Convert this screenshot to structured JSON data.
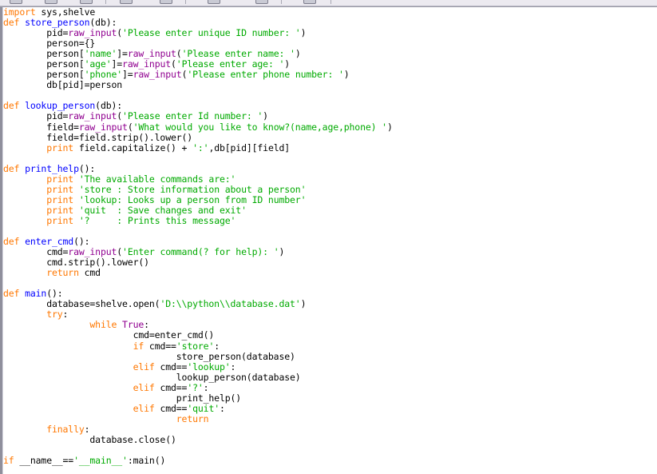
{
  "window": {
    "kind": "python-code-editor",
    "background": "#ffffff",
    "frame_color": "#8f8f9c",
    "toolbar_color": "#eceaf0"
  },
  "palette": {
    "keyword": "#ff7700",
    "definition": "#0000ff",
    "string": "#00aa00",
    "builtin": "#900090",
    "plain": "#000000",
    "background": "#ffffff"
  },
  "toolbar": {
    "visible_sliver": true,
    "button_positions": [
      12,
      56,
      100,
      150,
      200,
      260,
      320,
      380
    ],
    "separator_positions": [
      132,
      232,
      352,
      414
    ]
  },
  "editor": {
    "language": "Python 2",
    "font_size_px": 11.5,
    "line_height_px": 13.05,
    "indent_unit": "tab",
    "code_lines": [
      [
        [
          "import",
          "kw"
        ],
        [
          " sys,shelve",
          "plain"
        ]
      ],
      [
        [
          "def",
          "kw"
        ],
        [
          " ",
          "plain"
        ],
        [
          "store_person",
          "def"
        ],
        [
          "(db):",
          "plain"
        ]
      ],
      [
        [
          "        pid=",
          "plain"
        ],
        [
          "raw_input",
          "bi"
        ],
        [
          "(",
          "plain"
        ],
        [
          "'Please enter unique ID number: '",
          "str"
        ],
        [
          ")",
          "plain"
        ]
      ],
      [
        [
          "        person={}",
          "plain"
        ]
      ],
      [
        [
          "        person[",
          "plain"
        ],
        [
          "'name'",
          "str"
        ],
        [
          "]=",
          "plain"
        ],
        [
          "raw_input",
          "bi"
        ],
        [
          "(",
          "plain"
        ],
        [
          "'Please enter name: '",
          "str"
        ],
        [
          ")",
          "plain"
        ]
      ],
      [
        [
          "        person[",
          "plain"
        ],
        [
          "'age'",
          "str"
        ],
        [
          "]=",
          "plain"
        ],
        [
          "raw_input",
          "bi"
        ],
        [
          "(",
          "plain"
        ],
        [
          "'Please enter age: '",
          "str"
        ],
        [
          ")",
          "plain"
        ]
      ],
      [
        [
          "        person[",
          "plain"
        ],
        [
          "'phone'",
          "str"
        ],
        [
          "]=",
          "plain"
        ],
        [
          "raw_input",
          "bi"
        ],
        [
          "(",
          "plain"
        ],
        [
          "'Please enter phone number: '",
          "str"
        ],
        [
          ")",
          "plain"
        ]
      ],
      [
        [
          "        db[pid]=person",
          "plain"
        ]
      ],
      [
        [
          "",
          "plain"
        ]
      ],
      [
        [
          "def",
          "kw"
        ],
        [
          " ",
          "plain"
        ],
        [
          "lookup_person",
          "def"
        ],
        [
          "(db):",
          "plain"
        ]
      ],
      [
        [
          "        pid=",
          "plain"
        ],
        [
          "raw_input",
          "bi"
        ],
        [
          "(",
          "plain"
        ],
        [
          "'Please enter Id number: '",
          "str"
        ],
        [
          ")",
          "plain"
        ]
      ],
      [
        [
          "        field=",
          "plain"
        ],
        [
          "raw_input",
          "bi"
        ],
        [
          "(",
          "plain"
        ],
        [
          "'What would you like to know?(name,age,phone) '",
          "str"
        ],
        [
          ")",
          "plain"
        ]
      ],
      [
        [
          "        field=field.strip().lower()",
          "plain"
        ]
      ],
      [
        [
          "        ",
          "plain"
        ],
        [
          "print",
          "kw"
        ],
        [
          " field.capitalize() + ",
          "plain"
        ],
        [
          "':'",
          "str"
        ],
        [
          ",db[pid][field]",
          "plain"
        ]
      ],
      [
        [
          "",
          "plain"
        ]
      ],
      [
        [
          "def",
          "kw"
        ],
        [
          " ",
          "plain"
        ],
        [
          "print_help",
          "def"
        ],
        [
          "():",
          "plain"
        ]
      ],
      [
        [
          "        ",
          "plain"
        ],
        [
          "print",
          "kw"
        ],
        [
          " ",
          "plain"
        ],
        [
          "'The available commands are:'",
          "str"
        ]
      ],
      [
        [
          "        ",
          "plain"
        ],
        [
          "print",
          "kw"
        ],
        [
          " ",
          "plain"
        ],
        [
          "'store : Store information about a person'",
          "str"
        ]
      ],
      [
        [
          "        ",
          "plain"
        ],
        [
          "print",
          "kw"
        ],
        [
          " ",
          "plain"
        ],
        [
          "'lookup: Looks up a person from ID number'",
          "str"
        ]
      ],
      [
        [
          "        ",
          "plain"
        ],
        [
          "print",
          "kw"
        ],
        [
          " ",
          "plain"
        ],
        [
          "'quit  : Save changes and exit'",
          "str"
        ]
      ],
      [
        [
          "        ",
          "plain"
        ],
        [
          "print",
          "kw"
        ],
        [
          " ",
          "plain"
        ],
        [
          "'?     : Prints this message'",
          "str"
        ]
      ],
      [
        [
          "",
          "plain"
        ]
      ],
      [
        [
          "def",
          "kw"
        ],
        [
          " ",
          "plain"
        ],
        [
          "enter_cmd",
          "def"
        ],
        [
          "():",
          "plain"
        ]
      ],
      [
        [
          "        cmd=",
          "plain"
        ],
        [
          "raw_input",
          "bi"
        ],
        [
          "(",
          "plain"
        ],
        [
          "'Enter command(? for help): '",
          "str"
        ],
        [
          ")",
          "plain"
        ]
      ],
      [
        [
          "        cmd.strip().lower()",
          "plain"
        ]
      ],
      [
        [
          "        ",
          "plain"
        ],
        [
          "return",
          "kw"
        ],
        [
          " cmd",
          "plain"
        ]
      ],
      [
        [
          "",
          "plain"
        ]
      ],
      [
        [
          "def",
          "kw"
        ],
        [
          " ",
          "plain"
        ],
        [
          "main",
          "def"
        ],
        [
          "():",
          "plain"
        ]
      ],
      [
        [
          "        database=shelve.open(",
          "plain"
        ],
        [
          "'D:\\\\python\\\\database.dat'",
          "str"
        ],
        [
          ")",
          "plain"
        ]
      ],
      [
        [
          "        ",
          "plain"
        ],
        [
          "try",
          "kw"
        ],
        [
          ":",
          "plain"
        ]
      ],
      [
        [
          "                ",
          "plain"
        ],
        [
          "while",
          "kw"
        ],
        [
          " ",
          "plain"
        ],
        [
          "True",
          "bi"
        ],
        [
          ":",
          "plain"
        ]
      ],
      [
        [
          "                        cmd=enter_cmd()",
          "plain"
        ]
      ],
      [
        [
          "                        ",
          "plain"
        ],
        [
          "if",
          "kw"
        ],
        [
          " cmd==",
          "plain"
        ],
        [
          "'store'",
          "str"
        ],
        [
          ":",
          "plain"
        ]
      ],
      [
        [
          "                                store_person(database)",
          "plain"
        ]
      ],
      [
        [
          "                        ",
          "plain"
        ],
        [
          "elif",
          "kw"
        ],
        [
          " cmd==",
          "plain"
        ],
        [
          "'lookup'",
          "str"
        ],
        [
          ":",
          "plain"
        ]
      ],
      [
        [
          "                                lookup_person(database)",
          "plain"
        ]
      ],
      [
        [
          "                        ",
          "plain"
        ],
        [
          "elif",
          "kw"
        ],
        [
          " cmd==",
          "plain"
        ],
        [
          "'?'",
          "str"
        ],
        [
          ":",
          "plain"
        ]
      ],
      [
        [
          "                                print_help()",
          "plain"
        ]
      ],
      [
        [
          "                        ",
          "plain"
        ],
        [
          "elif",
          "kw"
        ],
        [
          " cmd==",
          "plain"
        ],
        [
          "'quit'",
          "str"
        ],
        [
          ":",
          "plain"
        ]
      ],
      [
        [
          "                                ",
          "plain"
        ],
        [
          "return",
          "kw"
        ]
      ],
      [
        [
          "        ",
          "plain"
        ],
        [
          "finally",
          "kw"
        ],
        [
          ":",
          "plain"
        ]
      ],
      [
        [
          "                database.close()",
          "plain"
        ]
      ],
      [
        [
          "",
          "plain"
        ]
      ],
      [
        [
          "if",
          "kw"
        ],
        [
          " __name__==",
          "plain"
        ],
        [
          "'__main__'",
          "str"
        ],
        [
          ":main()",
          "plain"
        ]
      ]
    ]
  }
}
